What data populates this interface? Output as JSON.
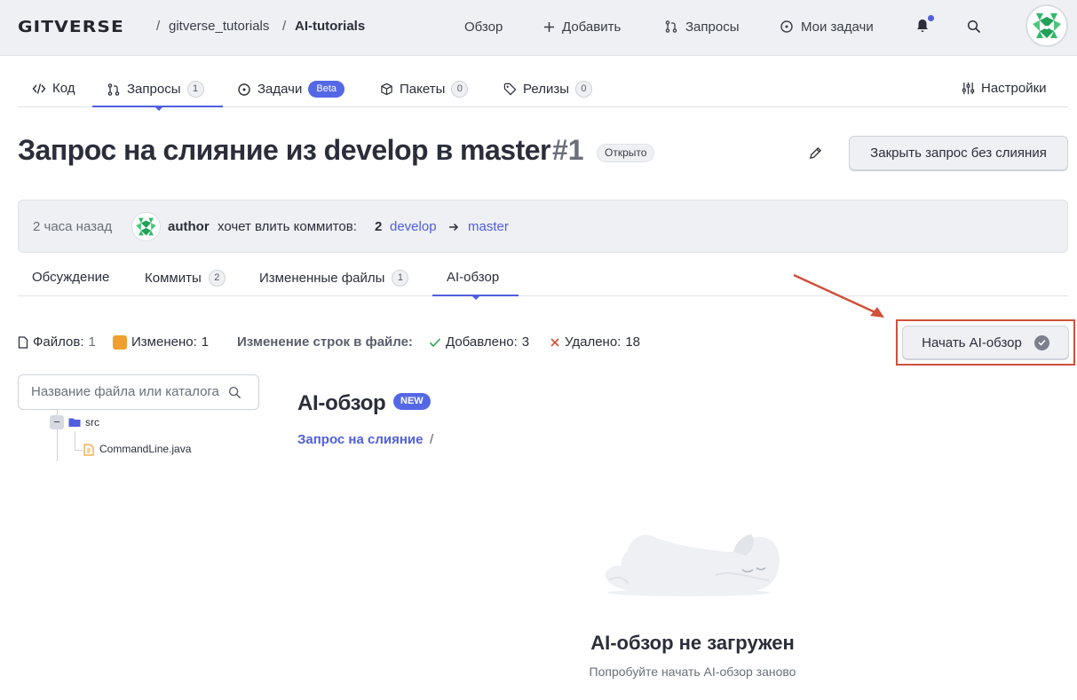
{
  "header": {
    "logo": "GITVERSE",
    "breadcrumb": {
      "owner": "gitverse_tutorials",
      "sep1": "/",
      "repo": "AI-tutorials",
      "sep0": "/"
    },
    "nav": {
      "overview": "Обзор",
      "add": "Добавить",
      "requests": "Запросы",
      "my_tasks": "Мои задачи"
    }
  },
  "repo_tabs": {
    "code": "Код",
    "requests": {
      "label": "Запросы",
      "count": "1"
    },
    "tasks": {
      "label": "Задачи",
      "badge": "Beta"
    },
    "packages": {
      "label": "Пакеты",
      "count": "0"
    },
    "releases": {
      "label": "Релизы",
      "count": "0"
    },
    "settings": "Настройки"
  },
  "pr": {
    "title": "Запрос на слияние из develop в master",
    "number": "#1",
    "status": "Открыто",
    "close_button": "Закрыть запрос без слияния",
    "info": {
      "time": "2 часа назад",
      "author": "author",
      "text": "хочет влить коммитов:",
      "commits": "2",
      "source_branch": "develop",
      "target_branch": "master"
    }
  },
  "pr_tabs": {
    "discussion": "Обсуждение",
    "commits": {
      "label": "Коммиты",
      "count": "2"
    },
    "changed_files": {
      "label": "Измененные файлы",
      "count": "1"
    },
    "ai_review": "AI-обзор"
  },
  "stats": {
    "files_label": "Файлов:",
    "files_value": "1",
    "changed_label": "Изменено:",
    "changed_value": "1",
    "lines_label": "Изменение строк в файле:",
    "added_label": "Добавлено:",
    "added_value": "3",
    "deleted_label": "Удалено:",
    "deleted_value": "18",
    "start_ai_button": "Начать AI-обзор"
  },
  "file_tree": {
    "search_placeholder": "Название файла или каталога",
    "folder": "src",
    "file": "CommandLine.java"
  },
  "ai_panel": {
    "title": "AI-обзор",
    "badge": "NEW",
    "crumb": "Запрос на слияние",
    "crumb_sep": "/",
    "empty_title": "AI-обзор не загружен",
    "empty_subtitle": "Попробуйте начать AI-обзор заново"
  },
  "colors": {
    "accent": "#4f5fe0",
    "badge": "#5468e6",
    "annotation": "#d0503a",
    "modified": "#f0a030",
    "added": "#2ea44f",
    "deleted": "#d0503a"
  },
  "icons": [
    "code-icon",
    "pull-request-icon",
    "issue-icon",
    "package-icon",
    "tag-icon",
    "settings-sliders-icon",
    "bell-icon",
    "search-icon",
    "plus-icon",
    "edit-icon",
    "arrow-right-icon",
    "file-icon",
    "check-icon",
    "cross-icon",
    "folder-icon",
    "java-file-icon",
    "check-circle-icon",
    "sleeping-dog-illustration"
  ]
}
